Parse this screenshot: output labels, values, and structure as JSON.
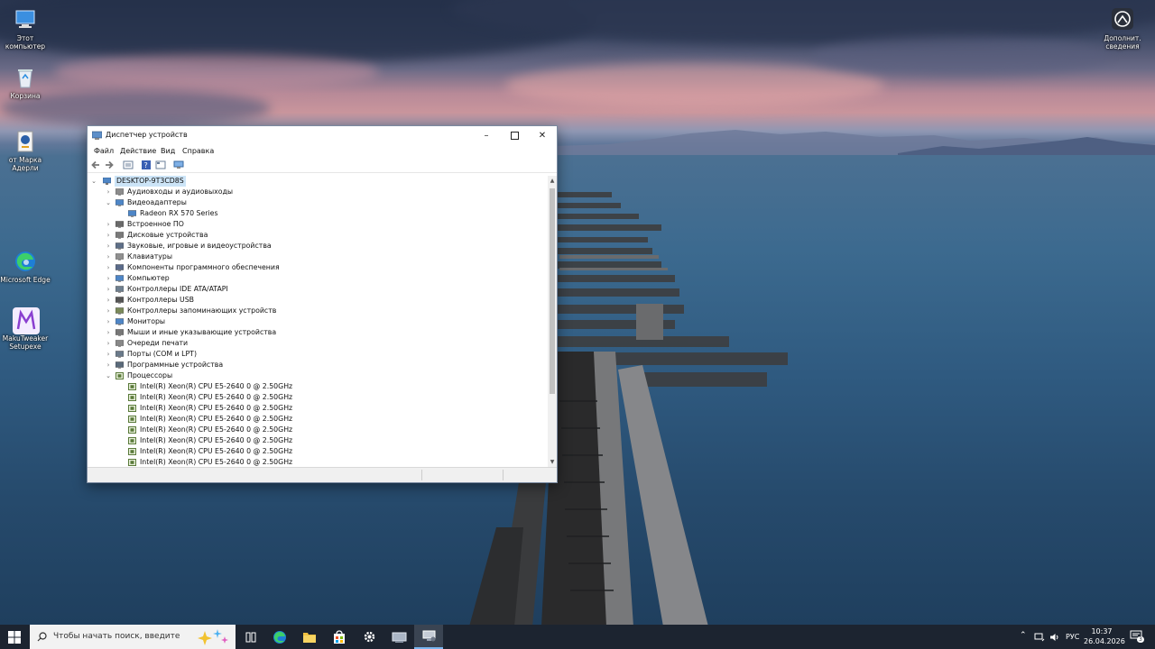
{
  "desktop_icons": [
    {
      "label": "Этот компьютер",
      "icon": "this-pc-icon"
    },
    {
      "label": "Корзина",
      "icon": "recycle-bin-icon"
    },
    {
      "label": "от Марка Адерли",
      "icon": "shortcut-icon"
    },
    {
      "label": "Microsoft Edge",
      "icon": "edge-icon"
    },
    {
      "label": "MakuTweaker Setupexe",
      "icon": "makutweaker-icon"
    }
  ],
  "widget": {
    "label": "Дополнит. сведения",
    "icon": "info-widget-icon"
  },
  "window": {
    "title": "Диспетчер устройств",
    "menu": [
      "Файл",
      "Действие",
      "Вид",
      "Справка"
    ],
    "root": "DESKTOP-9T3CD8S",
    "tree": [
      {
        "label": "Аудиовходы и аудиовыходы",
        "level": 1,
        "state": "collapsed",
        "icon": "audio-io-icon"
      },
      {
        "label": "Видеоадаптеры",
        "level": 1,
        "state": "expanded",
        "icon": "display-adapter-icon"
      },
      {
        "label": "Radeon RX 570 Series",
        "level": 2,
        "state": "leaf",
        "icon": "display-adapter-icon"
      },
      {
        "label": "Встроенное ПО",
        "level": 1,
        "state": "collapsed",
        "icon": "firmware-icon"
      },
      {
        "label": "Дисковые устройства",
        "level": 1,
        "state": "collapsed",
        "icon": "disk-drive-icon"
      },
      {
        "label": "Звуковые, игровые и видеоустройства",
        "level": 1,
        "state": "collapsed",
        "icon": "sound-icon"
      },
      {
        "label": "Клавиатуры",
        "level": 1,
        "state": "collapsed",
        "icon": "keyboard-icon"
      },
      {
        "label": "Компоненты программного обеспечения",
        "level": 1,
        "state": "collapsed",
        "icon": "software-component-icon"
      },
      {
        "label": "Компьютер",
        "level": 1,
        "state": "collapsed",
        "icon": "computer-icon"
      },
      {
        "label": "Контроллеры IDE ATA/ATAPI",
        "level": 1,
        "state": "collapsed",
        "icon": "ide-controller-icon"
      },
      {
        "label": "Контроллеры USB",
        "level": 1,
        "state": "collapsed",
        "icon": "usb-icon"
      },
      {
        "label": "Контроллеры запоминающих устройств",
        "level": 1,
        "state": "collapsed",
        "icon": "storage-controller-icon"
      },
      {
        "label": "Мониторы",
        "level": 1,
        "state": "collapsed",
        "icon": "monitor-icon"
      },
      {
        "label": "Мыши и иные указывающие устройства",
        "level": 1,
        "state": "collapsed",
        "icon": "mouse-icon"
      },
      {
        "label": "Очереди печати",
        "level": 1,
        "state": "collapsed",
        "icon": "print-queue-icon"
      },
      {
        "label": "Порты (COM и LPT)",
        "level": 1,
        "state": "collapsed",
        "icon": "port-icon"
      },
      {
        "label": "Программные устройства",
        "level": 1,
        "state": "collapsed",
        "icon": "software-device-icon"
      },
      {
        "label": "Процессоры",
        "level": 1,
        "state": "expanded",
        "icon": "processor-icon"
      },
      {
        "label": "Intel(R) Xeon(R) CPU E5-2640 0 @ 2.50GHz",
        "level": 2,
        "state": "leaf",
        "icon": "processor-icon"
      },
      {
        "label": "Intel(R) Xeon(R) CPU E5-2640 0 @ 2.50GHz",
        "level": 2,
        "state": "leaf",
        "icon": "processor-icon"
      },
      {
        "label": "Intel(R) Xeon(R) CPU E5-2640 0 @ 2.50GHz",
        "level": 2,
        "state": "leaf",
        "icon": "processor-icon"
      },
      {
        "label": "Intel(R) Xeon(R) CPU E5-2640 0 @ 2.50GHz",
        "level": 2,
        "state": "leaf",
        "icon": "processor-icon"
      },
      {
        "label": "Intel(R) Xeon(R) CPU E5-2640 0 @ 2.50GHz",
        "level": 2,
        "state": "leaf",
        "icon": "processor-icon"
      },
      {
        "label": "Intel(R) Xeon(R) CPU E5-2640 0 @ 2.50GHz",
        "level": 2,
        "state": "leaf",
        "icon": "processor-icon"
      },
      {
        "label": "Intel(R) Xeon(R) CPU E5-2640 0 @ 2.50GHz",
        "level": 2,
        "state": "leaf",
        "icon": "processor-icon"
      },
      {
        "label": "Intel(R) Xeon(R) CPU E5-2640 0 @ 2.50GHz",
        "level": 2,
        "state": "leaf",
        "icon": "processor-icon"
      }
    ]
  },
  "taskbar": {
    "search_placeholder": "Чтобы начать поиск, введите",
    "lang": "РУС",
    "time": "10:37",
    "date": "26.04.2026",
    "notification_count": "3"
  }
}
